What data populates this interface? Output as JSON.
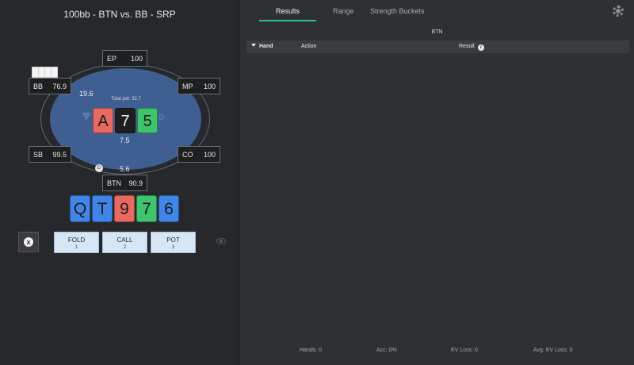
{
  "left": {
    "title": "100bb - BTN vs. BB - SRP",
    "pot_label": "Total pot: 32.7",
    "felt_logo": "ND",
    "seats": {
      "ep": {
        "pos": "EP",
        "stack": "100"
      },
      "bb": {
        "pos": "BB",
        "stack": "76.9"
      },
      "mp": {
        "pos": "MP",
        "stack": "100"
      },
      "sb": {
        "pos": "SB",
        "stack": "99.5"
      },
      "co": {
        "pos": "CO",
        "stack": "100"
      },
      "btn": {
        "pos": "BTN",
        "stack": "90.9"
      }
    },
    "bets": {
      "bb": "19.6",
      "center": "7.5",
      "btn": "5.6"
    },
    "dealer_button": "D",
    "board": [
      {
        "rank": "A",
        "color": "#e8695f"
      },
      {
        "rank": "7",
        "color": "#1f1f1f"
      },
      {
        "rank": "5",
        "color": "#3ec46a"
      }
    ],
    "hole": [
      {
        "rank": "Q",
        "color": "#3f86e8"
      },
      {
        "rank": "T",
        "color": "#3f86e8"
      },
      {
        "rank": "9",
        "color": "#e8695f"
      },
      {
        "rank": "7",
        "color": "#3ec46a"
      },
      {
        "rank": "6",
        "color": "#3f86e8"
      }
    ],
    "clear_icon": "x",
    "actions": [
      {
        "label": "FOLD",
        "key": "1"
      },
      {
        "label": "CALL",
        "key": "2"
      },
      {
        "label": "POT",
        "key": "3"
      }
    ]
  },
  "right": {
    "tabs": [
      "Results",
      "Range",
      "Strength Buckets"
    ],
    "active_tab": "Results",
    "player": "BTN",
    "columns": {
      "hand": "Hand",
      "action": "Action",
      "result": "Result"
    },
    "info_icon": "i",
    "footer": {
      "hands": "Hands: 0",
      "acc": "Acc: 0%",
      "ev_loss": "EV Loss: 0",
      "avg_ev_loss": "Avg. EV Loss: 0"
    }
  },
  "colors": {
    "accent": "#2cc38b",
    "felt": "#3f5e92",
    "action_button": "#d6e6f5"
  }
}
